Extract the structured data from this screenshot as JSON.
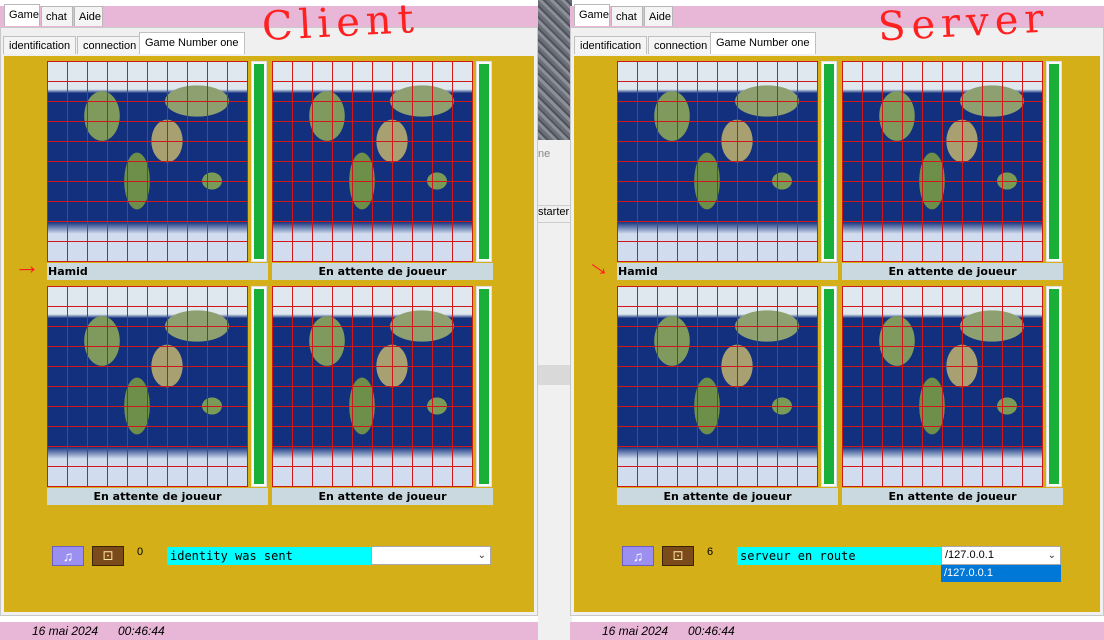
{
  "tabs_top": [
    "Game",
    "chat",
    "Aide"
  ],
  "tabs_inner": [
    "identification",
    "connection",
    "Game Number one"
  ],
  "background": {
    "partial_1": "ne",
    "partial_2": "starter"
  },
  "annotations": {
    "client": "Client",
    "server": "Server",
    "arrow": "→"
  },
  "client": {
    "boards": [
      {
        "label": "Hamid",
        "gauge_level": 1.0
      },
      {
        "label": "En attente de joueur",
        "gauge_level": 1.0
      },
      {
        "label": "En attente de joueur",
        "gauge_level": 1.0
      },
      {
        "label": "En attente de joueur",
        "gauge_level": 1.0
      }
    ],
    "music_icon": "music-note-icon",
    "dice_icon": "dice-icon",
    "counter": "0",
    "status_text": "identity was sent",
    "combo_value": "",
    "date": "16 mai 2024",
    "time": "00:46:44"
  },
  "server": {
    "boards": [
      {
        "label": "Hamid",
        "gauge_level": 1.0
      },
      {
        "label": "En attente de joueur",
        "gauge_level": 1.0
      },
      {
        "label": "En attente de joueur",
        "gauge_level": 1.0
      },
      {
        "label": "En attente de joueur",
        "gauge_level": 1.0
      }
    ],
    "music_icon": "music-note-icon",
    "dice_icon": "dice-icon",
    "counter": "6",
    "status_text": "serveur en route",
    "combo_value": "/127.0.0.1",
    "combo_option": "/127.0.0.1",
    "date": "16 mai 2024",
    "time": "00:46:44"
  },
  "colors": {
    "panel": "#d4af17",
    "tabbar": "#e8b6d6",
    "status": "#00ffff",
    "gauge": "#18b038",
    "grid": "#d01818",
    "annotation": "#ff2020"
  }
}
